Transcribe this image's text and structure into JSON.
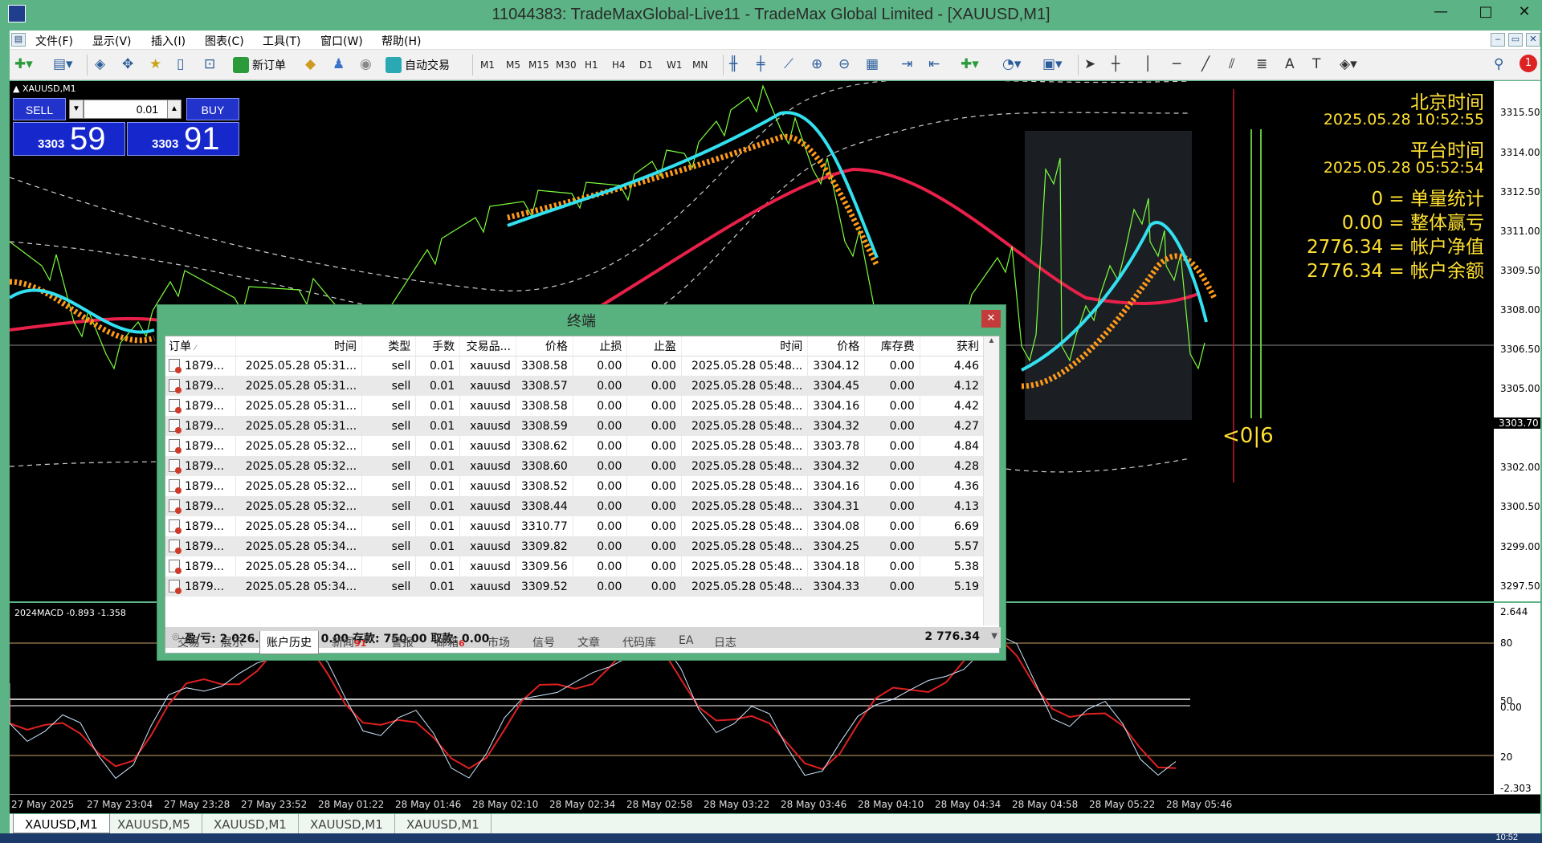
{
  "window": {
    "title": "11044383: TradeMaxGlobal-Live11 - TradeMax Global Limited - [XAUUSD,M1]",
    "min_glyph": "—",
    "max_glyph": "□",
    "close_glyph": "✕"
  },
  "menu": [
    "文件(F)",
    "显示(V)",
    "插入(I)",
    "图表(C)",
    "工具(T)",
    "窗口(W)",
    "帮助(H)"
  ],
  "toolbar": {
    "new_order": "新订单",
    "auto_trading": "自动交易",
    "timeframes": [
      "M1",
      "M5",
      "M15",
      "M30",
      "H1",
      "H4",
      "D1",
      "W1",
      "MN"
    ],
    "notification_count": "1",
    "text_tool_a": "A",
    "text_tool_t": "T"
  },
  "chart": {
    "symbol_label": "XAUUSD,M1",
    "current_price": "3303.70",
    "price_labels": [
      "3315.50",
      "3314.00",
      "3312.50",
      "3311.00",
      "3309.50",
      "3308.00",
      "3306.50",
      "3305.00",
      "3302.00",
      "3300.50",
      "3299.00",
      "3297.50"
    ],
    "macd_label": "2024MACD -0.893 -1.358",
    "macd_labels": [
      "2.644",
      "80",
      "50",
      "0.00",
      "20",
      "-2.303"
    ],
    "time_labels": [
      "27 May 2025",
      "27 May 23:04",
      "27 May 23:28",
      "27 May 23:52",
      "28 May 01:22",
      "28 May 01:46",
      "28 May 02:10",
      "28 May 02:34",
      "28 May 02:58",
      "28 May 03:22",
      "28 May 03:46",
      "28 May 04:10",
      "28 May 04:34",
      "28 May 04:58",
      "28 May 05:22",
      "28 May 05:46"
    ],
    "overlay_text": "<0|6",
    "colors": {
      "red_ma": "#e8204a",
      "cyan_ma": "#33e0f0",
      "candles": "#7cff3c",
      "orange_band": "#ff9a1a",
      "info_text": "#ffe032"
    }
  },
  "trade_panel": {
    "sell_label": "SELL",
    "buy_label": "BUY",
    "lot": "0.01",
    "sell_price_prefix": "3303",
    "sell_price_big": "59",
    "buy_price_prefix": "3303",
    "buy_price_big": "91"
  },
  "info": {
    "beijing_label": "北京时间",
    "beijing_time": "2025.05.28 10:52:55",
    "platform_label": "平台时间",
    "platform_time": "2025.05.28 05:52:54",
    "single_stat": "0 = 单量统计",
    "total_pnl": "0.00 = 整体赢亏",
    "equity": "2776.34 = 帐户净值",
    "balance": "2776.34 = 帐户余额"
  },
  "terminal": {
    "title": "终端",
    "close": "✕",
    "sort_glyph": "⁄",
    "columns": [
      "订单",
      "时间",
      "类型",
      "手数",
      "交易品...",
      "价格",
      "止损",
      "止盈",
      "时间",
      "价格",
      "库存费",
      "获利"
    ],
    "rows": [
      [
        "1879...",
        "2025.05.28 05:31...",
        "sell",
        "0.01",
        "xauusd",
        "3308.58",
        "0.00",
        "0.00",
        "2025.05.28 05:48...",
        "3304.12",
        "0.00",
        "4.46"
      ],
      [
        "1879...",
        "2025.05.28 05:31...",
        "sell",
        "0.01",
        "xauusd",
        "3308.57",
        "0.00",
        "0.00",
        "2025.05.28 05:48...",
        "3304.45",
        "0.00",
        "4.12"
      ],
      [
        "1879...",
        "2025.05.28 05:31...",
        "sell",
        "0.01",
        "xauusd",
        "3308.58",
        "0.00",
        "0.00",
        "2025.05.28 05:48...",
        "3304.16",
        "0.00",
        "4.42"
      ],
      [
        "1879...",
        "2025.05.28 05:31...",
        "sell",
        "0.01",
        "xauusd",
        "3308.59",
        "0.00",
        "0.00",
        "2025.05.28 05:48...",
        "3304.32",
        "0.00",
        "4.27"
      ],
      [
        "1879...",
        "2025.05.28 05:32...",
        "sell",
        "0.01",
        "xauusd",
        "3308.62",
        "0.00",
        "0.00",
        "2025.05.28 05:48...",
        "3303.78",
        "0.00",
        "4.84"
      ],
      [
        "1879...",
        "2025.05.28 05:32...",
        "sell",
        "0.01",
        "xauusd",
        "3308.60",
        "0.00",
        "0.00",
        "2025.05.28 05:48...",
        "3304.32",
        "0.00",
        "4.28"
      ],
      [
        "1879...",
        "2025.05.28 05:32...",
        "sell",
        "0.01",
        "xauusd",
        "3308.52",
        "0.00",
        "0.00",
        "2025.05.28 05:48...",
        "3304.16",
        "0.00",
        "4.36"
      ],
      [
        "1879...",
        "2025.05.28 05:32...",
        "sell",
        "0.01",
        "xauusd",
        "3308.44",
        "0.00",
        "0.00",
        "2025.05.28 05:48...",
        "3304.31",
        "0.00",
        "4.13"
      ],
      [
        "1879...",
        "2025.05.28 05:34...",
        "sell",
        "0.01",
        "xauusd",
        "3310.77",
        "0.00",
        "0.00",
        "2025.05.28 05:48...",
        "3304.08",
        "0.00",
        "6.69"
      ],
      [
        "1879...",
        "2025.05.28 05:34...",
        "sell",
        "0.01",
        "xauusd",
        "3309.82",
        "0.00",
        "0.00",
        "2025.05.28 05:48...",
        "3304.25",
        "0.00",
        "5.57"
      ],
      [
        "1879...",
        "2025.05.28 05:34...",
        "sell",
        "0.01",
        "xauusd",
        "3309.56",
        "0.00",
        "0.00",
        "2025.05.28 05:48...",
        "3304.18",
        "0.00",
        "5.38"
      ],
      [
        "1879...",
        "2025.05.28 05:34...",
        "sell",
        "0.01",
        "xauusd",
        "3309.52",
        "0.00",
        "0.00",
        "2025.05.28 05:48...",
        "3304.33",
        "0.00",
        "5.19"
      ]
    ],
    "summary": "盈/亏: 2 026.34  信用额: 0.00  存款: 750.00  取款: 0.00",
    "summary_total": "2 776.34",
    "tabs": [
      "交易",
      "展示",
      "账户历史",
      "新闻",
      "警报",
      "邮箱",
      "市场",
      "信号",
      "文章",
      "代码库",
      "EA",
      "日志"
    ],
    "news_badge": "91",
    "mail_badge": "6"
  },
  "chart_tabs": [
    "XAUUSD,M1",
    "XAUUSD,M5",
    "XAUUSD,M1",
    "XAUUSD,M1",
    "XAUUSD,M1"
  ],
  "taskbar": {
    "clock": "10:52"
  }
}
